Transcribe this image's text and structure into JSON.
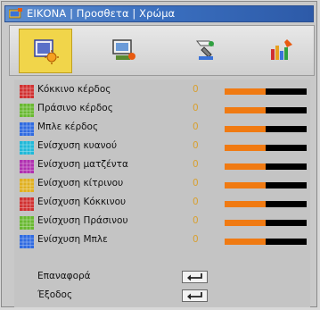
{
  "title": "ΕΙΚΟΝΑ | Προσθετα | Χρώμα",
  "tabs": [
    {
      "icon": "picture-settings-icon",
      "active": true
    },
    {
      "icon": "screen-settings-icon",
      "active": false
    },
    {
      "icon": "setup-tools-icon",
      "active": false
    },
    {
      "icon": "options-icon",
      "active": false
    }
  ],
  "rows": [
    {
      "label": "Κόκκινο κέρδος",
      "value": "0",
      "level": 0.5,
      "swatch": "#d03030"
    },
    {
      "label": "Πράσινο κέρδος",
      "value": "0",
      "level": 0.5,
      "swatch": "#68b830"
    },
    {
      "label": "Μπλε κέρδος",
      "value": "0",
      "level": 0.5,
      "swatch": "#2f6ae0"
    },
    {
      "label": "Ενίσχυση κυανού",
      "value": "0",
      "level": 0.5,
      "swatch": "#20b8d8"
    },
    {
      "label": "Ενίσχυση ματζέντα",
      "value": "0",
      "level": 0.5,
      "swatch": "#b030b0"
    },
    {
      "label": "Ενίσχυση κίτρινου",
      "value": "0",
      "level": 0.5,
      "swatch": "#e0b020"
    },
    {
      "label": "Ενίσχυση Κόκκινου",
      "value": "0",
      "level": 0.5,
      "swatch": "#d03030"
    },
    {
      "label": "Ενίσχυση Πράσινου",
      "value": "0",
      "level": 0.5,
      "swatch": "#68b830"
    },
    {
      "label": "Ενίσχυση Μπλε",
      "value": "0",
      "level": 0.5,
      "swatch": "#2f6ae0"
    }
  ],
  "actions": [
    {
      "label": "Επαναφορά",
      "icon": "enter-icon"
    },
    {
      "label": "Έξοδος",
      "icon": "enter-icon"
    }
  ]
}
